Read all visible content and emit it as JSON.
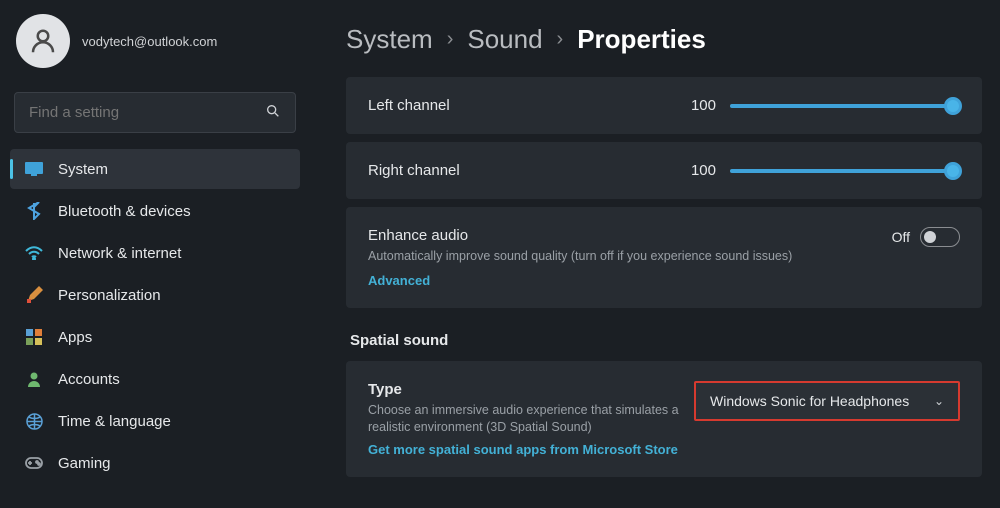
{
  "account": {
    "email": "vodytech@outlook.com"
  },
  "search": {
    "placeholder": "Find a setting"
  },
  "nav": [
    {
      "label": "System"
    },
    {
      "label": "Bluetooth & devices"
    },
    {
      "label": "Network & internet"
    },
    {
      "label": "Personalization"
    },
    {
      "label": "Apps"
    },
    {
      "label": "Accounts"
    },
    {
      "label": "Time & language"
    },
    {
      "label": "Gaming"
    }
  ],
  "breadcrumb": {
    "a": "System",
    "b": "Sound",
    "c": "Properties"
  },
  "channels": {
    "left": {
      "label": "Left channel",
      "value": "100"
    },
    "right": {
      "label": "Right channel",
      "value": "100"
    }
  },
  "enhance": {
    "title": "Enhance audio",
    "desc": "Automatically improve sound quality (turn off if you experience sound issues)",
    "advanced": "Advanced",
    "toggle_text": "Off"
  },
  "spatial": {
    "section": "Spatial sound",
    "title": "Type",
    "desc": "Choose an immersive audio experience that simulates a realistic environment (3D Spatial Sound)",
    "link": "Get more spatial sound apps from Microsoft Store",
    "dropdown": "Windows Sonic for Headphones"
  }
}
